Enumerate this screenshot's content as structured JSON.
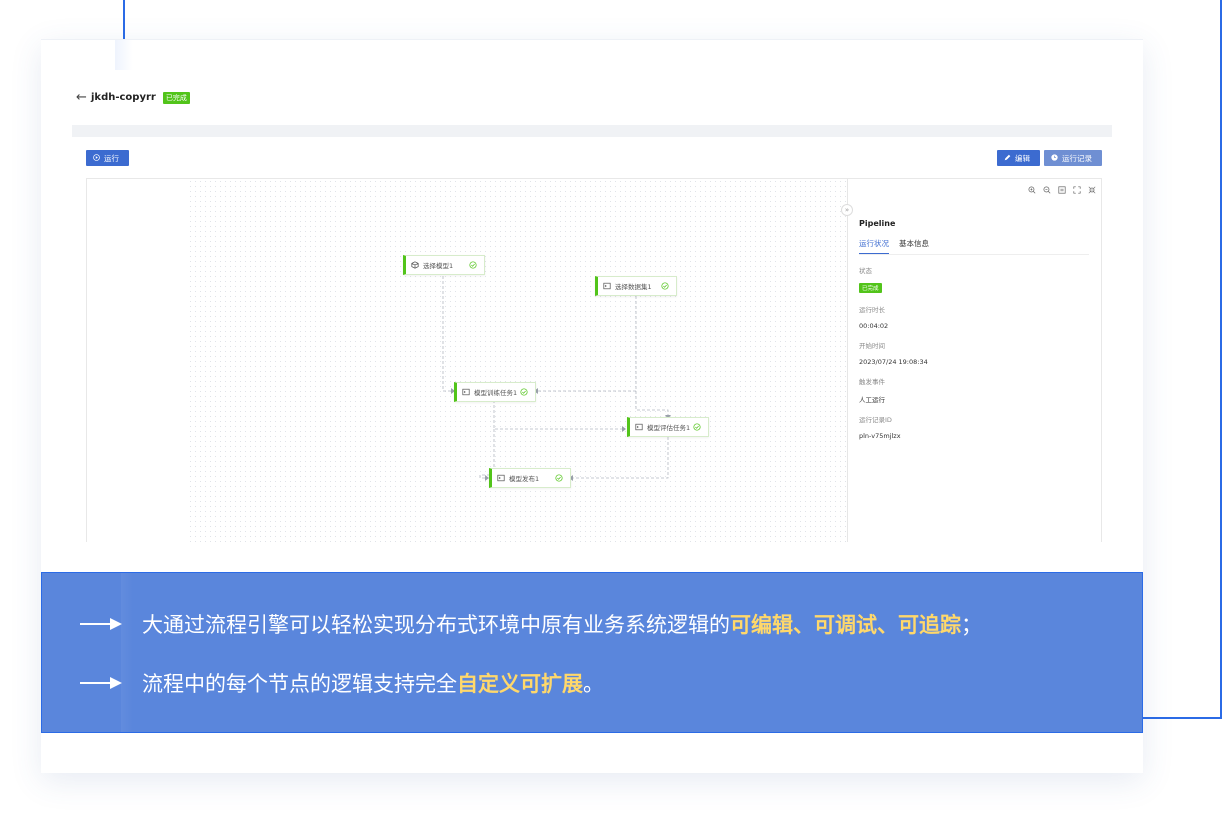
{
  "header": {
    "title": "jkdh-copyrr",
    "status_tag": "已完成"
  },
  "toolbar": {
    "run_label": "运行",
    "edit_label": "编辑",
    "history_label": "运行记录"
  },
  "pipeline": {
    "nodes": [
      {
        "label": "选择模型1",
        "icon": "cube-icon",
        "status": "success"
      },
      {
        "label": "选择数据集1",
        "icon": "terminal-icon",
        "status": "success"
      },
      {
        "label": "模型训练任务1",
        "icon": "terminal-icon",
        "status": "success"
      },
      {
        "label": "模型评估任务1",
        "icon": "terminal-icon",
        "status": "success"
      },
      {
        "label": "模型发布1",
        "icon": "terminal-icon",
        "status": "success"
      }
    ],
    "canvas_tools": [
      "zoom-in-icon",
      "zoom-out-icon",
      "fit-view-icon",
      "fullscreen-icon",
      "collapse-view-icon"
    ]
  },
  "side_panel": {
    "title": "Pipeline",
    "tabs": [
      "运行状况",
      "基本信息"
    ],
    "fields": {
      "status_label": "状态",
      "status_value": "已完成",
      "duration_label": "运行时长",
      "duration_value": "00:04:02",
      "start_label": "开始时间",
      "start_value": "2023/07/24 19:08:34",
      "trigger_label": "触发事件",
      "trigger_value": "人工运行",
      "record_label": "运行记录ID",
      "record_value": "pln-v75mjlzx"
    }
  },
  "banner": {
    "line1_text": "大通过流程引擎可以轻松实现分布式环境中原有业务系统逻辑的",
    "line1_highlight": "可编辑、可调试、可追踪",
    "line1_end": "；",
    "line2_text": "流程中的每个节点的逻辑支持完全",
    "line2_highlight": "自定义可扩展",
    "line2_end": "。"
  },
  "colors": {
    "accent": "#3c6bd0",
    "success": "#52c41a",
    "banner_bg": "#5a86dc",
    "highlight": "#ffd86b"
  }
}
